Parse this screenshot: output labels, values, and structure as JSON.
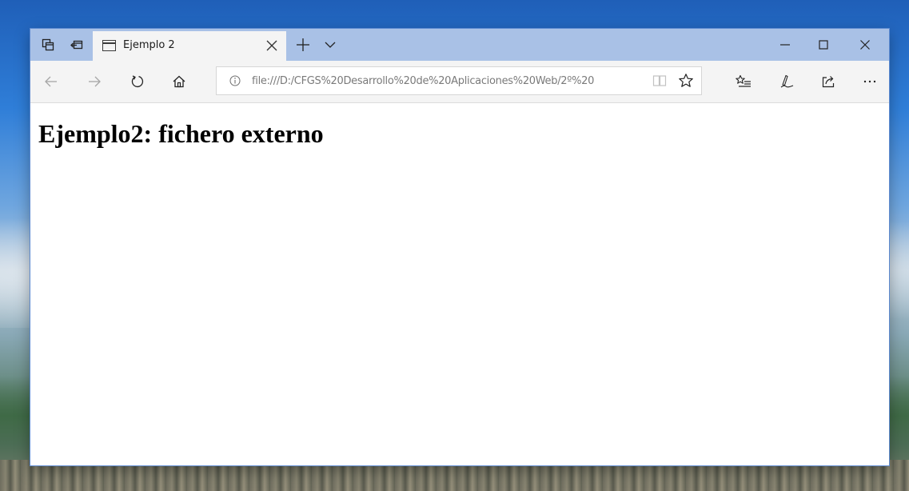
{
  "browser": {
    "tab": {
      "title": "Ejemplo 2"
    },
    "address": {
      "url": "file:///D:/CFGS%20Desarrollo%20de%20Aplicaciones%20Web/2º%20"
    }
  },
  "page": {
    "heading": "Ejemplo2: fichero externo"
  },
  "icons": {
    "tab_actions": "tab-actions-icon",
    "set_aside": "set-aside-tabs-icon",
    "tab_page": "page-icon",
    "close": "close-icon",
    "new_tab": "plus-icon",
    "tab_preview": "chevron-down-icon",
    "minimize": "minimize-icon",
    "maximize": "maximize-icon",
    "window_close": "close-icon",
    "back": "arrow-left-icon",
    "forward": "arrow-right-icon",
    "refresh": "refresh-icon",
    "home": "home-icon",
    "info": "info-icon",
    "reading_view": "book-icon",
    "favorite": "star-icon",
    "favorites_hub": "favorites-list-icon",
    "web_note": "pen-icon",
    "share": "share-icon",
    "more": "more-dots-icon"
  },
  "colors": {
    "titlebar": "#a9c1e6",
    "toolbar": "#f4f4f4",
    "active_tab": "#f4f4f4",
    "url_text": "#7a7a7a"
  }
}
